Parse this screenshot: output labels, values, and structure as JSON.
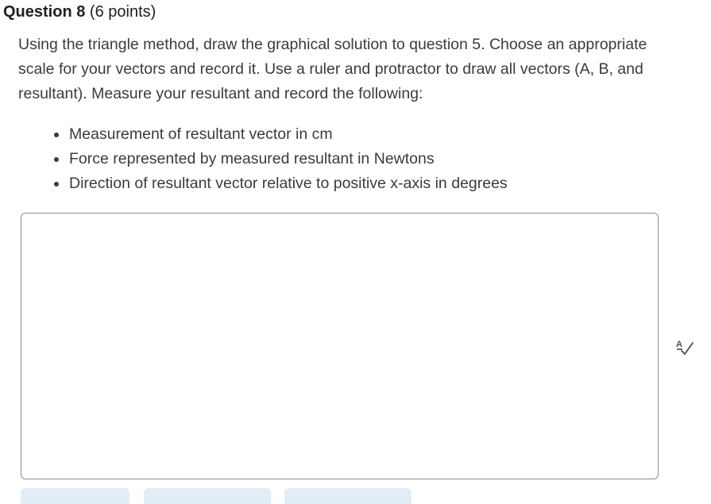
{
  "question": {
    "title": "Question 8",
    "points": "(6 points)"
  },
  "prompt": "Using the triangle method, draw the graphical solution to question 5. Choose an appropriate scale for your vectors and record it. Use a ruler and protractor to draw all vectors (A, B, and resultant). Measure your resultant and record the following:",
  "bullets": [
    "Measurement of resultant vector in cm",
    "Force represented by measured resultant in Newtons",
    "Direction of resultant vector relative to positive x-axis in degrees"
  ],
  "answer_box": {
    "value": ""
  },
  "icons": {
    "spellcheck": "spellcheck-icon"
  },
  "colors": {
    "text": "#3b3b3b",
    "heading": "#202122",
    "border": "#8a8d91",
    "button_bg": "#e3edf7",
    "icon": "#494c4e"
  }
}
